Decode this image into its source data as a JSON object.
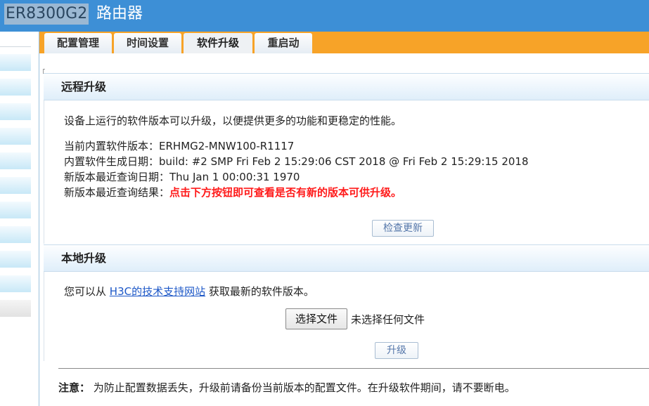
{
  "titlebar": {
    "model": "ER8300G2",
    "name": "路由器"
  },
  "tabs": [
    {
      "label": "配置管理"
    },
    {
      "label": "时间设置"
    },
    {
      "label": "软件升级"
    },
    {
      "label": "重启动"
    }
  ],
  "active_tab": "软件升级",
  "remote": {
    "header": "远程升级",
    "intro": "设备上运行的软件版本可以升级，以便提供更多的功能和更稳定的性能。",
    "version_label": "当前内置软件版本：",
    "version_value": "ERHMG2-MNW100-R1117",
    "build_label": "内置软件生成日期：",
    "build_value": "build: #2 SMP Fri Feb 2 15:29:06 CST 2018 @ Fri Feb 2 15:29:15 2018",
    "last_check_label": "新版本最近查询日期：",
    "last_check_value": "Thu Jan 1 00:00:31 1970",
    "result_label": "新版本最近查询结果：",
    "result_value": "点击下方按钮即可查看是否有新的版本可供升级。",
    "check_button": "检查更新"
  },
  "local": {
    "header": "本地升级",
    "text_before": "您可以从",
    "link_text": "H3C的技术支持网站",
    "text_after": "获取最新的软件版本。",
    "choose_file_button": "选择文件",
    "no_file_text": "未选择任何文件",
    "upgrade_button": "升级"
  },
  "note": {
    "label": "注意：",
    "text": "为防止配置数据丢失，升级前请备份当前版本的配置文件。在升级软件期间，请不要断电。"
  },
  "colors": {
    "titlebar": "#3d8fd6",
    "tabbar": "#f7a328",
    "warning_text": "#ff1a1a",
    "link": "#1c57c7"
  }
}
